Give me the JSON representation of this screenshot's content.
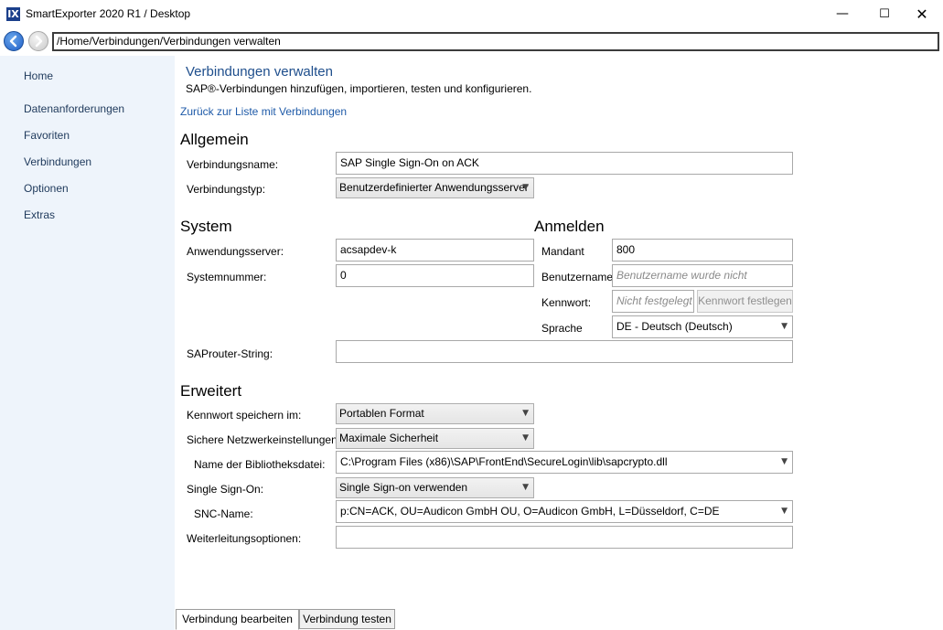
{
  "window": {
    "title": "SmartExporter 2020 R1 / Desktop",
    "app_icon": "IX",
    "minimize": "—",
    "maximize": "☐",
    "close": "✕"
  },
  "navigation": {
    "address": "/Home/Verbindungen/Verbindungen verwalten"
  },
  "sidebar": {
    "items": [
      {
        "label": "Home"
      },
      {
        "label": "Datenanforderungen"
      },
      {
        "label": "Favoriten"
      },
      {
        "label": "Verbindungen"
      },
      {
        "label": "Optionen"
      },
      {
        "label": "Extras"
      }
    ]
  },
  "page": {
    "title": "Verbindungen verwalten",
    "subtitle": "SAP®-Verbindungen hinzufügen, importieren, testen und konfigurieren.",
    "back_link": "Zurück zur Liste mit Verbindungen"
  },
  "general": {
    "heading": "Allgemein",
    "name_label": "Verbindungsname:",
    "name_value": "SAP Single Sign-On on ACK",
    "type_label": "Verbindungstyp:",
    "type_value": "Benutzerdefinierter Anwendungsserver"
  },
  "system": {
    "heading": "System",
    "server_label": "Anwendungsserver:",
    "server_value": "acsapdev-k",
    "sysnr_label": "Systemnummer:",
    "sysnr_value": "0",
    "saprouter_label": "SAProuter-String:",
    "saprouter_value": ""
  },
  "login": {
    "heading": "Anmelden",
    "client_label": "Mandant",
    "client_value": "800",
    "user_label": "Benutzername",
    "user_placeholder": "Benutzername wurde nicht festgelegt",
    "password_label": "Kennwort:",
    "password_placeholder": "Nicht festgelegt",
    "set_password_button": "Kennwort festlegen",
    "language_label": "Sprache",
    "language_value": "DE - Deutsch (Deutsch)"
  },
  "advanced": {
    "heading": "Erweitert",
    "save_pw_label": "Kennwort speichern im:",
    "save_pw_value": "Portablen Format",
    "security_label": "Sichere Netzwerkeinstellungen:",
    "security_value": "Maximale Sicherheit",
    "library_label": "Name der Bibliotheksdatei:",
    "library_value": "C:\\Program Files (x86)\\SAP\\FrontEnd\\SecureLogin\\lib\\sapcrypto.dll",
    "sso_label": "Single Sign-On:",
    "sso_value": "Single Sign-on verwenden",
    "snc_label": "SNC-Name:",
    "snc_value": "p:CN=ACK, OU=Audicon GmbH OU, O=Audicon GmbH, L=Düsseldorf, C=DE",
    "forward_label": "Weiterleitungsoptionen:",
    "forward_value": ""
  },
  "tabs": [
    {
      "label": "Verbindung bearbeiten",
      "active": true
    },
    {
      "label": "Verbindung testen",
      "active": false
    }
  ],
  "colors": {
    "sidebar_bg": "#eef4fb",
    "accent": "#1e4e8c",
    "link": "#1e5aa8"
  }
}
